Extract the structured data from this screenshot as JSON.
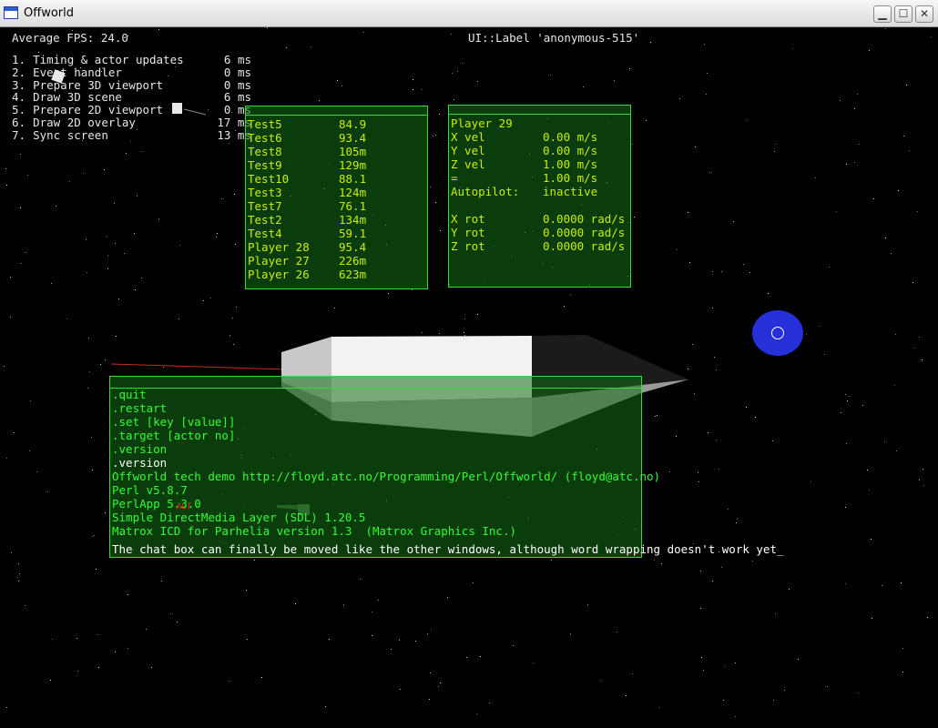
{
  "window": {
    "title": "Offworld"
  },
  "hud": {
    "fps_label": "Average FPS: 24.0",
    "ui_label": "UI::Label 'anonymous-515'"
  },
  "timing": [
    {
      "num": "1.",
      "name": "Timing & actor updates",
      "value": "6 ms"
    },
    {
      "num": "2.",
      "name": "Event handler",
      "value": "0 ms"
    },
    {
      "num": "3.",
      "name": "Prepare 3D viewport",
      "value": "0 ms"
    },
    {
      "num": "4.",
      "name": "Draw 3D scene",
      "value": "6 ms"
    },
    {
      "num": "5.",
      "name": "Prepare 2D viewport",
      "value": "0 ms"
    },
    {
      "num": "6.",
      "name": "Draw 2D overlay",
      "value": "17 ms"
    },
    {
      "num": "7.",
      "name": "Sync screen",
      "value": "13 ms"
    }
  ],
  "distance_list": [
    {
      "name": "Test5",
      "value": "84.9"
    },
    {
      "name": "Test6",
      "value": "93.4"
    },
    {
      "name": "Test8",
      "value": "105m"
    },
    {
      "name": "Test9",
      "value": "129m"
    },
    {
      "name": "Test10",
      "value": "88.1"
    },
    {
      "name": "Test3",
      "value": "124m"
    },
    {
      "name": "Test7",
      "value": "76.1"
    },
    {
      "name": "Test2",
      "value": "134m"
    },
    {
      "name": "Test4",
      "value": "59.1"
    },
    {
      "name": "Player 28",
      "value": "95.4"
    },
    {
      "name": "Player 27",
      "value": "226m"
    },
    {
      "name": "Player 26",
      "value": "623m"
    }
  ],
  "player_panel": {
    "name": "Player 29",
    "rows": [
      {
        "label": "X vel",
        "value": "0.00 m/s"
      },
      {
        "label": "Y vel",
        "value": "0.00 m/s"
      },
      {
        "label": "Z vel",
        "value": "1.00 m/s"
      },
      {
        "label": "=",
        "value": "1.00 m/s"
      },
      {
        "label": "Autopilot:",
        "value": "inactive"
      },
      {
        "label": "",
        "value": ""
      },
      {
        "label": "X rot",
        "value": "0.0000 rad/s"
      },
      {
        "label": "Y rot",
        "value": "0.0000 rad/s"
      },
      {
        "label": "Z rot",
        "value": "0.0000 rad/s"
      }
    ]
  },
  "chat": {
    "lines": [
      {
        "text": ".quit",
        "kind": "cmd"
      },
      {
        "text": ".restart",
        "kind": "cmd"
      },
      {
        "text": ".set [key [value]]",
        "kind": "cmd"
      },
      {
        "text": ".target [actor no]",
        "kind": "cmd"
      },
      {
        "text": ".version",
        "kind": "cmd"
      },
      {
        "text": ".version",
        "kind": "input"
      },
      {
        "text": "Offworld tech demo http://floyd.atc.no/Programming/Perl/Offworld/ (floyd@atc.no)",
        "kind": "cmd"
      },
      {
        "text": "Perl v5.8.7",
        "kind": "cmd"
      },
      {
        "text": "PerlApp 5.3.0",
        "kind": "cmd"
      },
      {
        "text": "Simple DirectMedia Layer (SDL) 1.20.5",
        "kind": "cmd"
      },
      {
        "text": "Matrox ICD for Parhelia version 1.3  (Matrox Graphics Inc.)",
        "kind": "cmd"
      }
    ],
    "input_text": "The chat box can finally be moved like the other windows, although word wrapping doesn't work yet_",
    "marker_label": "ALT"
  },
  "colors": {
    "panel_text": "#c8f000",
    "chat_cmd": "#33ff33",
    "chat_input": "#ffffff"
  }
}
